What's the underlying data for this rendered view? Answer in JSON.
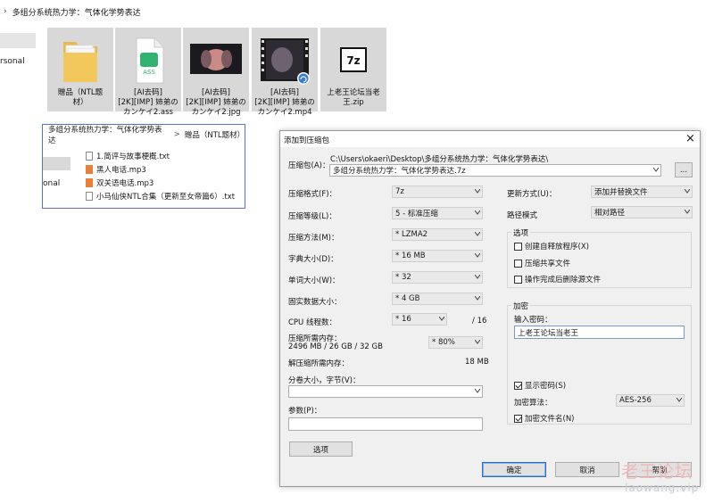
{
  "explorer": {
    "breadcrumb": "多组分系统热力学：气体化学势表达",
    "nav_left_text": "rsonal",
    "tiles": [
      {
        "caption": "贈品（NTL题材）",
        "type": "folder"
      },
      {
        "caption": "[AI去码][2K][IMP] 姉弟のカンケイ2.ass",
        "type": "ass",
        "badge": "ASS"
      },
      {
        "caption": "[AI去码][2K][IMP] 姉弟のカンケイ2.jpg",
        "type": "image"
      },
      {
        "caption": "[AI去码][2K][IMP] 姉弟のカンケイ2.mp4",
        "type": "video"
      },
      {
        "caption": "上老王论坛当老王.zip",
        "type": "7z",
        "badge": "7z"
      }
    ],
    "tile_captions": {
      "t0l1": "贈品（NTL题",
      "t0l2": "材）",
      "t1l1": "[AI去码]",
      "t1l2": "[2K][IMP] 姉弟の",
      "t1l3": "カンケイ2.ass",
      "t2l1": "[AI去码]",
      "t2l2": "[2K][IMP] 姉弟の",
      "t2l3": "カンケイ2.jpg",
      "t3l1": "[AI去码]",
      "t3l2": "[2K][IMP] 姉弟の",
      "t3l3": "カンケイ2.mp4",
      "t4l1": "上老王论坛当老",
      "t4l2": "王.zip"
    }
  },
  "popup": {
    "path_root": "多组分系统热力学：气体化学势表达",
    "path_sep": ">",
    "path_child": "贈品（NTL题材）",
    "nav_left_text": "onal",
    "files": [
      {
        "name": "1.简评与故事梗概.txt",
        "kind": "txt"
      },
      {
        "name": "黑人电话.mp3",
        "kind": "mp3"
      },
      {
        "name": "双关语电话.mp3",
        "kind": "mp3"
      },
      {
        "name": "小马仙侠NTL合集（更新至女帝篇6）.txt",
        "kind": "txt"
      }
    ]
  },
  "dialog": {
    "title": "添加到压缩包",
    "close_glyph": "×",
    "archive_label": "压缩包(A)：",
    "archive_dir": "C:\\Users\\okaeri\\Desktop\\多组分系统热力学：气体化学势表达\\",
    "archive_name": "多组分系统热力学：气体化学势表达.7z",
    "browse_label": "...",
    "format_label": "压缩格式(F)：",
    "format_value": "7z",
    "level_label": "压缩等级(L)：",
    "level_value": "5 - 标准压缩",
    "method_label": "压缩方法(M)：",
    "method_value": "* LZMA2",
    "dict_label": "字典大小(D)：",
    "dict_value": "* 16 MB",
    "word_label": "单词大小(W)：",
    "word_value": "* 32",
    "solid_label": "固实数据大小：",
    "solid_value": "* 4 GB",
    "threads_label": "CPU 线程数：",
    "threads_value": "* 16",
    "threads_total": "/ 16",
    "mem_comp_label": "压缩所需内存：",
    "mem_comp_detail": "2496 MB / 26 GB / 32 GB",
    "mem_comp_percent": "* 80%",
    "mem_decomp_label": "解压缩所需内存：",
    "mem_decomp_value": "18 MB",
    "split_label": "分卷大小，字节(V)：",
    "split_value": "",
    "params_label": "参数(P)：",
    "params_value": "",
    "options_btn": "选项",
    "update_label": "更新方式(U)：",
    "update_value": "添加并替换文件",
    "path_mode_label": "路径模式",
    "path_mode_value": "相对路径",
    "options_group": "选项",
    "opt_sfx": "创建自释放程序(X)",
    "opt_sfx_checked": false,
    "opt_shared": "压缩共享文件",
    "opt_shared_checked": false,
    "opt_delete": "操作完成后删除源文件",
    "opt_delete_checked": false,
    "encrypt_group": "加密",
    "password_label": "输入密码：",
    "password_value": "上老王论坛当老王",
    "show_password": "显示密码(S)",
    "show_password_checked": true,
    "enc_method_label": "加密算法：",
    "enc_method_value": "AES-256",
    "enc_names": "加密文件名(N)",
    "enc_names_checked": true,
    "ok": "确定",
    "cancel": "取消",
    "help": "帮助"
  },
  "watermark": {
    "line1": "老王论坛",
    "line2": "laowang.vip"
  },
  "colors": {
    "dialog_bg": "#f0f0f0",
    "popup_border": "#5b6fd0",
    "default_button_border": "#2a6bd0"
  }
}
